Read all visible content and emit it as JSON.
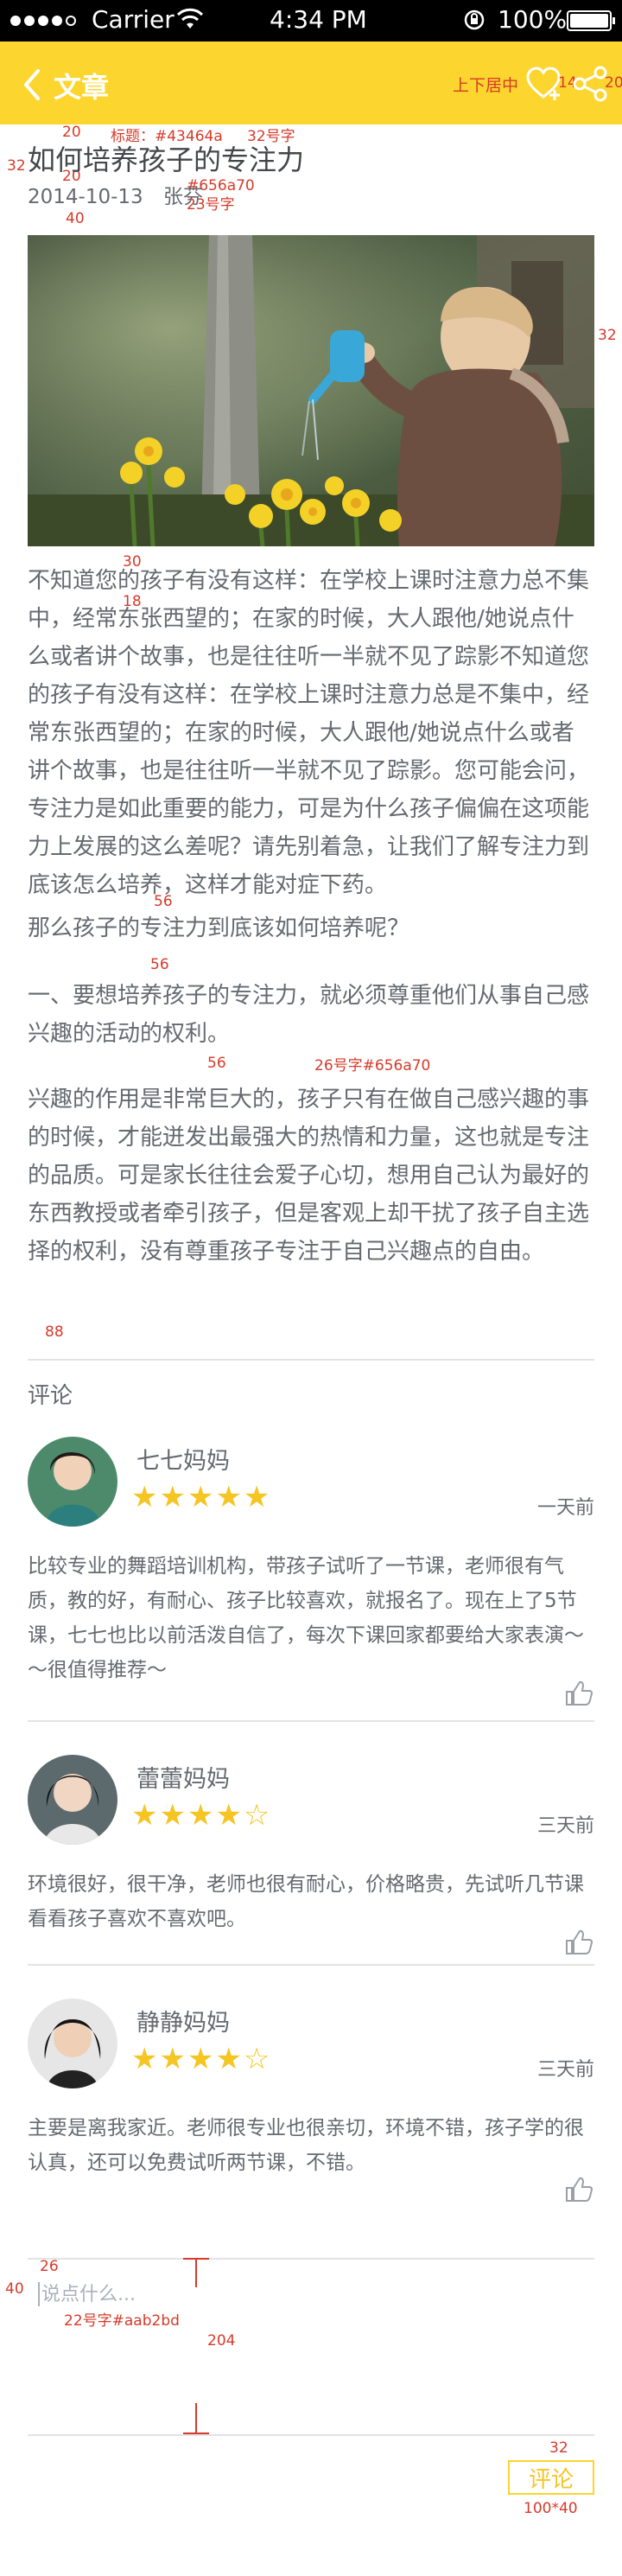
{
  "status_bar": {
    "carrier": "Carrier",
    "time": "4:34 PM",
    "battery": "100%"
  },
  "nav": {
    "title": "文章",
    "note": "上下居中",
    "note_fav": "14",
    "note_share": "20",
    "accent": "#fdd52f"
  },
  "annotations": {
    "a1": "20",
    "a2": "标题：#43464a",
    "a3": "32号字",
    "a4": "32",
    "a5": "20",
    "a6": "#656a70",
    "a7": "23号字",
    "a8": "40",
    "a9": "32",
    "a10": "30",
    "a11": "18",
    "a12": "56",
    "a13": "56",
    "a14": "56",
    "a15": "26号字#656a70",
    "a16": "88",
    "a17": "26",
    "a18": "40",
    "a19": "22号字#aab2bd",
    "a20": "204",
    "a21": "32",
    "a22": "100*40"
  },
  "article": {
    "title": "如何培养孩子的专注力",
    "date": "2014-10-13",
    "author": "张芬",
    "p1": "不知道您的孩子有没有这样：在学校上课时注意力总不集中，经常东张西望的；在家的时候，大人跟他/她说点什么或者讲个故事，也是往往听一半就不见了踪影不知道您的孩子有没有这样：在学校上课时注意力总是不集中，经常东张西望的；在家的时候，大人跟他/她说点什么或者讲个故事，也是往往听一半就不见了踪影。您可能会问，专注力是如此重要的能力，可是为什么孩子偏偏在这项能力上发展的这么差呢？请先别着急，让我们了解专注力到底该怎么培养，这样才能对症下药。",
    "p2": "那么孩子的专注力到底该如何培养呢？",
    "p3": "一、要想培养孩子的专注力，就必须尊重他们从事自己感兴趣的活动的权利。",
    "p4": "兴趣的作用是非常巨大的，孩子只有在做自己感兴趣的事的时候，才能迸发出最强大的热情和力量，这也就是专注的品质。可是家长往往会爱子心切，想用自己认为最好的东西教授或者牵引孩子，但是客观上却干扰了孩子自主选择的权利，没有尊重孩子专注于自己兴趣点的自由。"
  },
  "comments_section": {
    "title": "评论",
    "items": [
      {
        "name": "七七妈妈",
        "rating": 5,
        "date": "一天前",
        "text": "比较专业的舞蹈培训机构，带孩子试听了一节课，老师很有气质，教的好，有耐心、孩子比较喜欢，就报名了。现在上了5节课，七七也比以前活泼自信了，每次下课回家都要给大家表演～～很值得推荐～"
      },
      {
        "name": "蕾蕾妈妈",
        "rating": 4,
        "date": "三天前",
        "text": "环境很好，很干净，老师也很有耐心，价格略贵，先试听几节课看看孩子喜欢不喜欢吧。"
      },
      {
        "name": "静静妈妈",
        "rating": 4,
        "date": "三天前",
        "text": "主要是离我家近。老师很专业也很亲切，环境不错，孩子学的很认真，还可以免费试听两节课，不错。"
      }
    ]
  },
  "comment_input": {
    "placeholder": "说点什么...",
    "submit_label": "评论"
  }
}
